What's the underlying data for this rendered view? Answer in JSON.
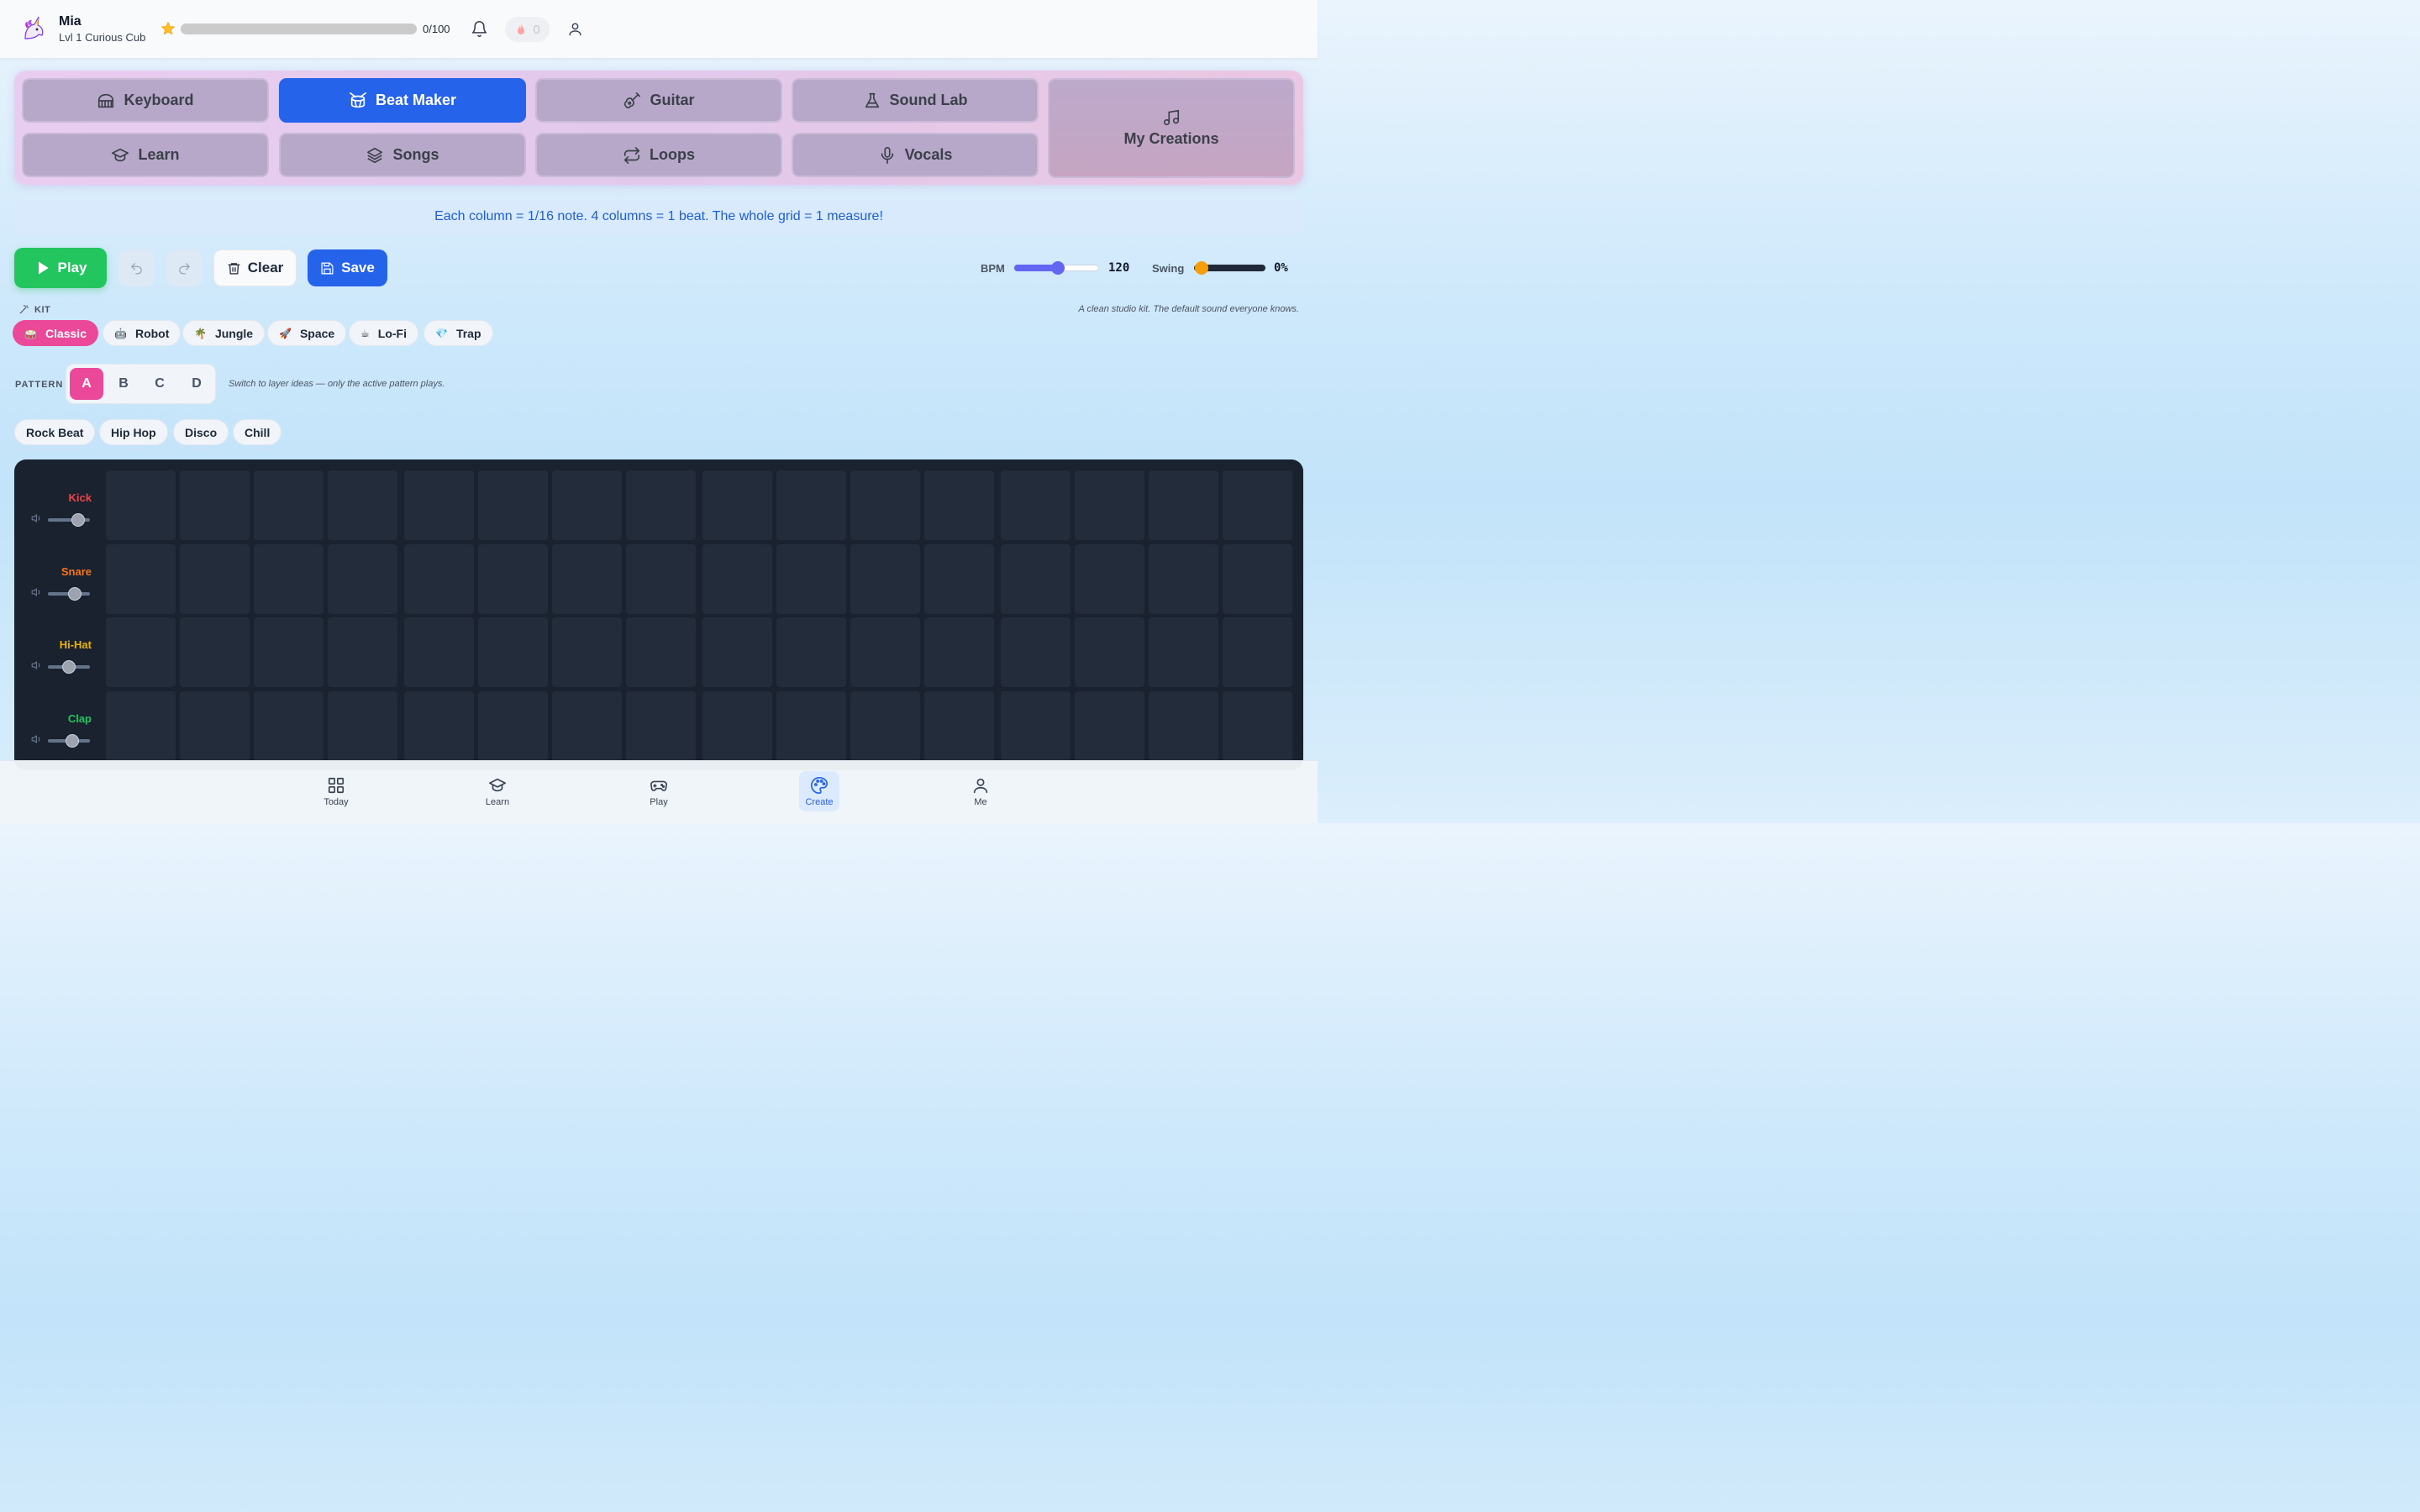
{
  "user": {
    "name": "Mia",
    "level": "Lvl 1 Curious Cub",
    "xp_text": "0/100",
    "xp_progress": 0,
    "streak": "0"
  },
  "tabs": [
    {
      "id": "keyboard",
      "label": "Keyboard",
      "icon": "keyboard-icon",
      "active": false
    },
    {
      "id": "beat-maker",
      "label": "Beat Maker",
      "icon": "drum-icon",
      "active": true
    },
    {
      "id": "guitar",
      "label": "Guitar",
      "icon": "guitar-icon",
      "active": false
    },
    {
      "id": "sound-lab",
      "label": "Sound Lab",
      "icon": "flask-icon",
      "active": false
    },
    {
      "id": "learn",
      "label": "Learn",
      "icon": "graduation-cap-icon",
      "active": false
    },
    {
      "id": "songs",
      "label": "Songs",
      "icon": "layers-icon",
      "active": false
    },
    {
      "id": "loops",
      "label": "Loops",
      "icon": "repeat-icon",
      "active": false
    },
    {
      "id": "vocals",
      "label": "Vocals",
      "icon": "mic-icon",
      "active": false
    },
    {
      "id": "my-creations",
      "label": "My Creations",
      "icon": "music-note-icon",
      "active": false
    }
  ],
  "info_banner": "Each column = 1/16 note. 4 columns = 1 beat. The whole grid = 1 measure!",
  "transport": {
    "play_label": "Play",
    "clear_label": "Clear",
    "save_label": "Save",
    "bpm_label": "BPM",
    "bpm_value": "120",
    "swing_label": "Swing",
    "swing_value": "0%"
  },
  "kit": {
    "label": "KIT",
    "description": "A clean studio kit. The default sound everyone knows.",
    "options": [
      {
        "label": "Classic",
        "emoji": "🥁",
        "active": true
      },
      {
        "label": "Robot",
        "emoji": "🤖",
        "active": false
      },
      {
        "label": "Jungle",
        "emoji": "🌴",
        "active": false
      },
      {
        "label": "Space",
        "emoji": "🚀",
        "active": false
      },
      {
        "label": "Lo-Fi",
        "emoji": "☕",
        "active": false
      },
      {
        "label": "Trap",
        "emoji": "💎",
        "active": false
      }
    ]
  },
  "pattern": {
    "label": "PATTERN",
    "options": [
      "A",
      "B",
      "C",
      "D"
    ],
    "active": "A",
    "hint": "Switch to layer ideas — only the active pattern plays."
  },
  "presets": [
    "Rock Beat",
    "Hip Hop",
    "Disco",
    "Chill"
  ],
  "tracks": [
    {
      "name": "Kick",
      "color": "#ef4444",
      "volume": 0.72
    },
    {
      "name": "Snare",
      "color": "#f97316",
      "volume": 0.64
    },
    {
      "name": "Hi-Hat",
      "color": "#eab308",
      "volume": 0.5
    },
    {
      "name": "Clap",
      "color": "#22c55e",
      "volume": 0.58
    }
  ],
  "steps_per_track": 16,
  "nav": [
    {
      "label": "Today",
      "icon": "grid-icon",
      "active": false
    },
    {
      "label": "Learn",
      "icon": "graduation-cap-icon",
      "active": false
    },
    {
      "label": "Play",
      "icon": "gamepad-icon",
      "active": false
    },
    {
      "label": "Create",
      "icon": "palette-icon",
      "active": true
    },
    {
      "label": "Me",
      "icon": "user-icon",
      "active": false
    }
  ],
  "colors": {
    "accent": "#2563eb",
    "play": "#22c55e",
    "pattern_active": "#ec4899",
    "bpm_slider": "#6366f1",
    "swing_slider": "#f59e0b"
  }
}
